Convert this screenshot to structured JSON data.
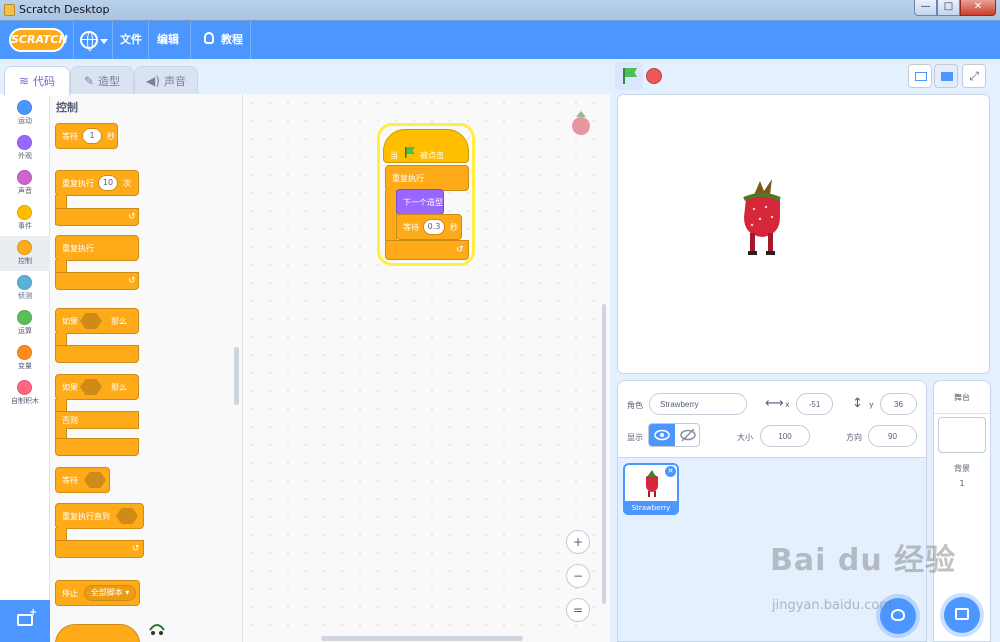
{
  "window": {
    "title": "Scratch Desktop",
    "min": "—",
    "max": "□",
    "close": "✕"
  },
  "menu": {
    "logo": "SCRATCH",
    "file": "文件",
    "edit": "编辑",
    "tutorials": "教程"
  },
  "tabs": [
    {
      "label": "代码",
      "icon": "code-icon"
    },
    {
      "label": "造型",
      "icon": "brush-icon"
    },
    {
      "label": "声音",
      "icon": "speaker-icon"
    }
  ],
  "categories": [
    {
      "label": "运动",
      "color": "#4c97ff"
    },
    {
      "label": "外观",
      "color": "#9966ff"
    },
    {
      "label": "声音",
      "color": "#cf63cf"
    },
    {
      "label": "事件",
      "color": "#ffbf00"
    },
    {
      "label": "控制",
      "color": "#ffab19"
    },
    {
      "label": "侦测",
      "color": "#5cb1d6"
    },
    {
      "label": "运算",
      "color": "#59c059"
    },
    {
      "label": "变量",
      "color": "#ff8c1a"
    },
    {
      "label": "自制积木",
      "color": "#ff6680"
    }
  ],
  "palette": {
    "heading": "控制",
    "wait": "等待",
    "wait_value": "1",
    "seconds": "秒",
    "repeat": "重复执行",
    "repeat_value": "10",
    "times": "次",
    "forever": "重复执行",
    "if": "如果",
    "then": "那么",
    "else": "否则",
    "wait_until": "等待",
    "repeat_until": "重复执行直到",
    "stop": "停止",
    "stop_option": "全部脚本 ▾"
  },
  "script": {
    "hat": "当",
    "hat_tail": "被点击",
    "forever": "重复执行",
    "next_costume": "下一个造型",
    "wait": "等待",
    "wait_value": "0.3",
    "seconds": "秒"
  },
  "zoom": {
    "in": "+",
    "out": "−",
    "reset": "="
  },
  "sprite_info": {
    "sprite_label": "角色",
    "sprite_name": "Strawberry",
    "x_label": "x",
    "x_value": "-51",
    "y_label": "y",
    "y_value": "36",
    "show_label": "显示",
    "size_label": "大小",
    "size_value": "100",
    "direction_label": "方向",
    "direction_value": "90"
  },
  "sprites": [
    {
      "name": "Strawberry",
      "delete": "✕"
    }
  ],
  "stage_panel": {
    "title": "舞台",
    "backdrops_label": "背景",
    "backdrops_count": "1"
  },
  "watermark": {
    "main": "Bai du 经验",
    "sub": "jingyan.baidu.com"
  },
  "colors": {
    "accent": "#4c97ff",
    "control": "#ffab19",
    "looks": "#9966ff",
    "event": "#ffbf00"
  }
}
